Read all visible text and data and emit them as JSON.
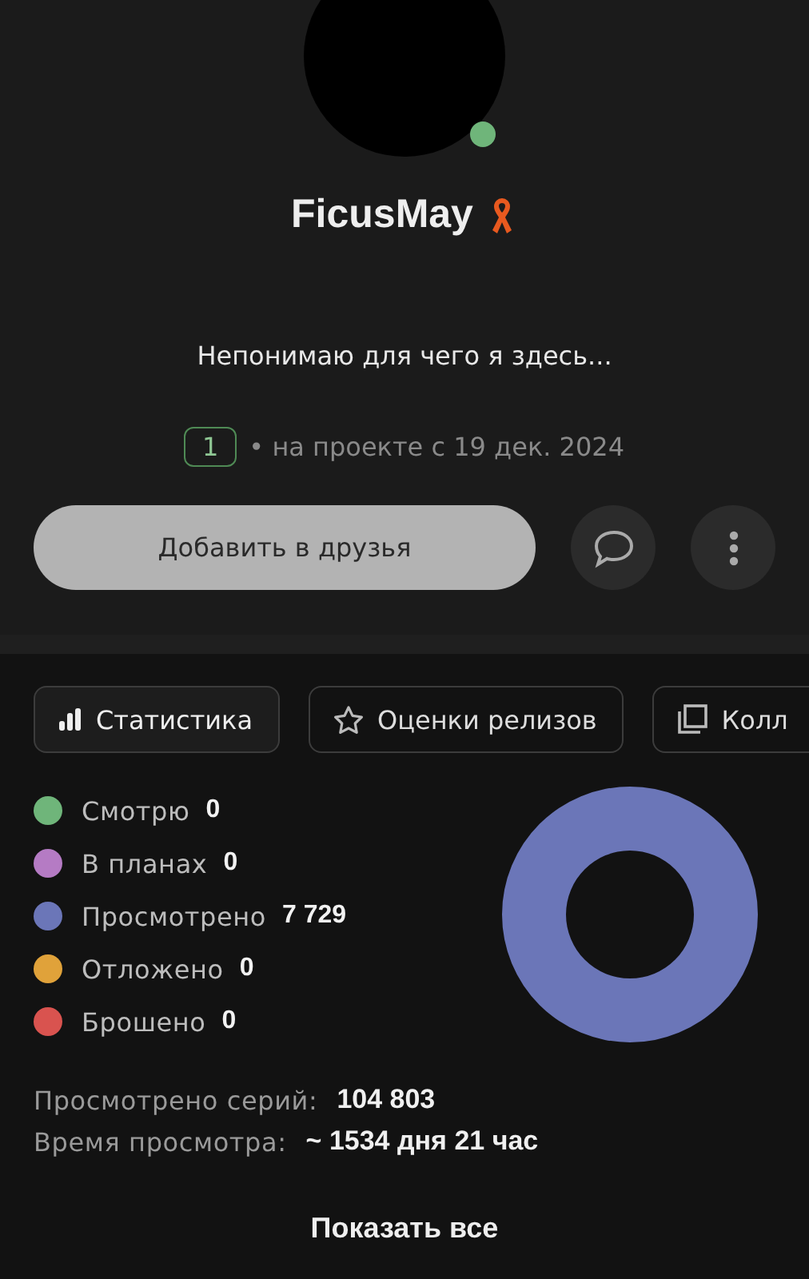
{
  "profile": {
    "username": "FicusMay",
    "online": true,
    "status": "Непонимаю для чего я здесь...",
    "level": "1",
    "joined": "• на проекте с 19 дек. 2024"
  },
  "actions": {
    "add_friend": "Добавить в друзья"
  },
  "tabs": [
    {
      "label": "Статистика",
      "selected": true,
      "kind": "stats"
    },
    {
      "label": "Оценки релизов",
      "selected": false,
      "kind": "ratings"
    },
    {
      "label": "Колл",
      "selected": false,
      "kind": "collections"
    }
  ],
  "stats": {
    "legend": [
      {
        "label": "Смотрю",
        "count": "0",
        "color": "#6fb57a"
      },
      {
        "label": "В планах",
        "count": "0",
        "color": "#b57bc4"
      },
      {
        "label": "Просмотрено",
        "count": "7 729",
        "color": "#6b76b8"
      },
      {
        "label": "Отложено",
        "count": "0",
        "color": "#e0a23a"
      },
      {
        "label": "Брошено",
        "count": "0",
        "color": "#d9534f"
      }
    ],
    "summary": [
      {
        "label": "Просмотрено серий:",
        "value": "104 803"
      },
      {
        "label": "Время просмотра:",
        "value": "~ 1534 дня 21 час"
      }
    ],
    "show_all": "Показать все"
  }
}
